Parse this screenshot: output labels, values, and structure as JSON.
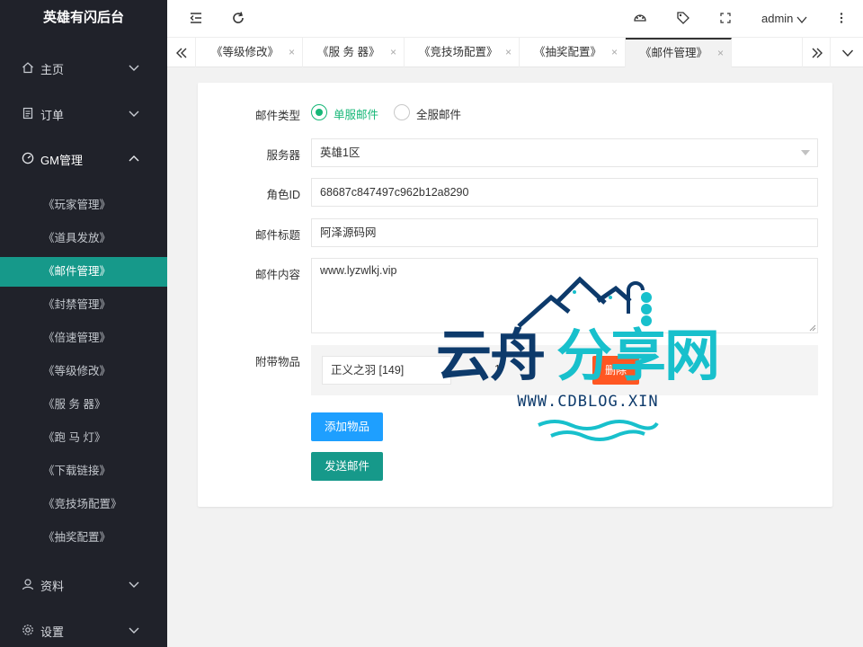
{
  "app": {
    "title": "英雄有闪后台"
  },
  "sidebar": {
    "groups": [
      {
        "label": "主页",
        "icon": "home-icon"
      },
      {
        "label": "订单",
        "icon": "order-icon"
      },
      {
        "label": "GM管理",
        "icon": "gauge-icon"
      },
      {
        "label": "资料",
        "icon": "user-icon"
      },
      {
        "label": "设置",
        "icon": "gear-icon"
      }
    ],
    "sub_items": [
      {
        "label": "《玩家管理》"
      },
      {
        "label": "《道具发放》"
      },
      {
        "label": "《邮件管理》"
      },
      {
        "label": "《封禁管理》"
      },
      {
        "label": "《倍速管理》"
      },
      {
        "label": "《等级修改》"
      },
      {
        "label": "《服 务 器》"
      },
      {
        "label": "《跑 马 灯》"
      },
      {
        "label": "《下载链接》"
      },
      {
        "label": "《竞技场配置》"
      },
      {
        "label": "《抽奖配置》"
      }
    ]
  },
  "topbar": {
    "user": "admin",
    "icons": [
      "collapse-menu-icon",
      "refresh-icon",
      "theme-icon",
      "tag-icon",
      "fullscreen-icon",
      "more-icon"
    ]
  },
  "tabs": [
    {
      "label": "《等级修改》",
      "close": "×"
    },
    {
      "label": "《服 务 器》",
      "close": "×"
    },
    {
      "label": "《竞技场配置》",
      "close": "×"
    },
    {
      "label": "《抽奖配置》",
      "close": "×"
    },
    {
      "label": "《邮件管理》",
      "close": "×"
    }
  ],
  "form": {
    "mail_type_label": "邮件类型",
    "mail_type_options": [
      "单服邮件",
      "全服邮件"
    ],
    "server_label": "服务器",
    "server_value": "英雄1区",
    "role_label": "角色ID",
    "role_value": "68687c847497c962b12a8290",
    "title_label": "邮件标题",
    "title_value": "阿泽源码网",
    "content_label": "邮件内容",
    "content_value": "www.lyzwlkj.vip",
    "items_label": "附带物品",
    "item_name": "正义之羽 [149]",
    "item_count": "1",
    "delete_label": "删除",
    "add_button": "添加物品",
    "send_button": "发送邮件"
  },
  "watermark": {
    "text_left": "云舟",
    "text_right": "分享网",
    "url": "WWW.CDBLOG.XIN"
  },
  "colors": {
    "sidebar_bg": "#20222a",
    "accent": "#16998a",
    "radio_green": "#16b777",
    "add_button": "#1e9fff",
    "send_button": "#16998a",
    "delete_button": "#ff5722"
  }
}
